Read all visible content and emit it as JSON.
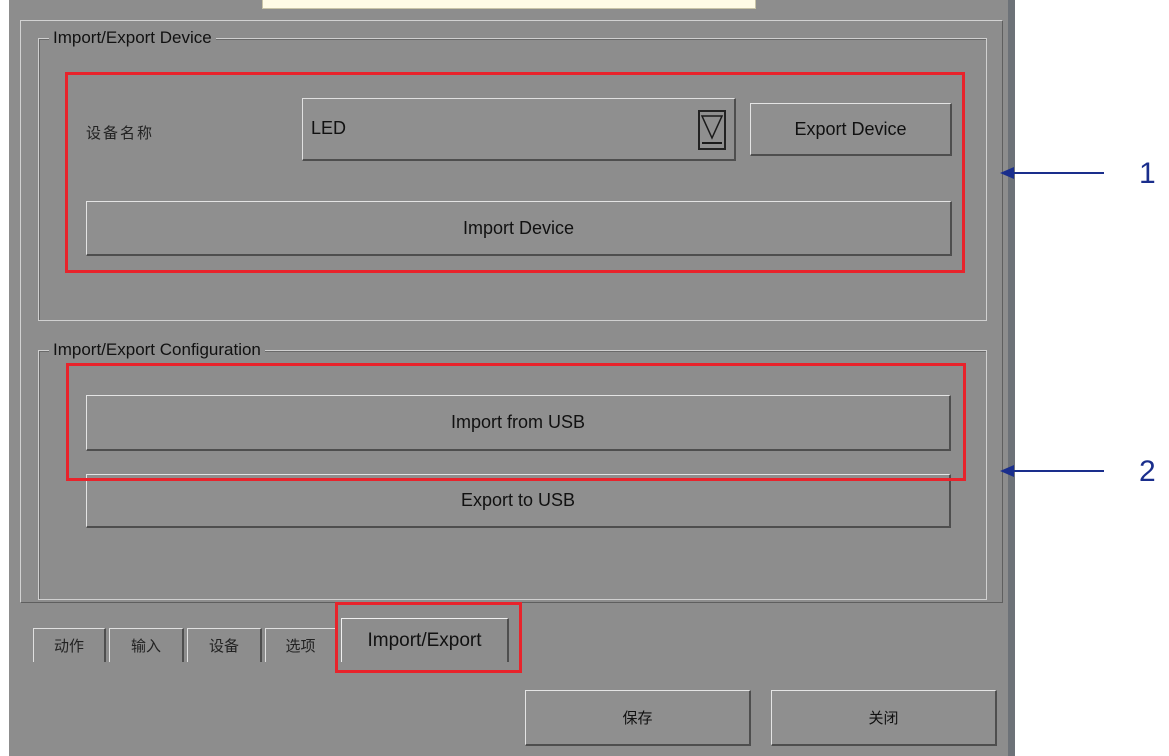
{
  "device_group": {
    "title": "Import/Export Device",
    "name_label": "设备名称",
    "device_select_value": "LED",
    "export_device_label": "Export Device",
    "import_device_label": "Import Device"
  },
  "config_group": {
    "title": "Import/Export Configuration",
    "import_usb_label": "Import from USB",
    "export_usb_label": "Export to USB"
  },
  "tabs": [
    {
      "label": "动作"
    },
    {
      "label": "输入"
    },
    {
      "label": "设备"
    },
    {
      "label": "选项"
    },
    {
      "label": "Import/Export",
      "active": true
    }
  ],
  "footer": {
    "save_label": "保存",
    "close_label": "关闭"
  },
  "annotations": [
    {
      "number": "1"
    },
    {
      "number": "2"
    }
  ],
  "colors": {
    "highlight": "#e8232b",
    "annotation_arrow": "#1a2e8c",
    "window_background": "#8d8d8d"
  }
}
